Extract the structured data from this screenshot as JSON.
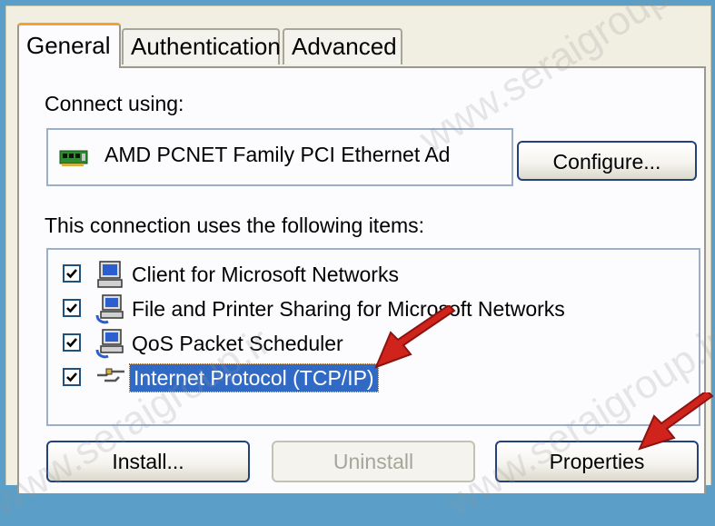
{
  "tabs": [
    {
      "label": "General",
      "active": true
    },
    {
      "label": "Authentication",
      "active": false
    },
    {
      "label": "Advanced",
      "active": false
    }
  ],
  "connect_using": {
    "label": "Connect using:",
    "adapter_name": "AMD PCNET Family PCI Ethernet Ad",
    "adapter_icon": "network-card-icon",
    "configure_label": "Configure..."
  },
  "items_section": {
    "label": "This connection uses the following items:",
    "items": [
      {
        "label": "Client for Microsoft Networks",
        "checked": true,
        "icon": "client-computer-icon",
        "selected": false
      },
      {
        "label": "File and Printer Sharing for Microsoft Networks",
        "checked": true,
        "icon": "file-printer-sharing-icon",
        "selected": false
      },
      {
        "label": "QoS Packet Scheduler",
        "checked": true,
        "icon": "qos-scheduler-icon",
        "selected": false
      },
      {
        "label": "Internet Protocol (TCP/IP)",
        "checked": true,
        "icon": "network-protocol-icon",
        "selected": true
      }
    ]
  },
  "buttons": {
    "install": "Install...",
    "uninstall": "Uninstall",
    "uninstall_enabled": false,
    "properties": "Properties"
  },
  "watermark": "www.seraigroup.ir",
  "colors": {
    "selection": "#316ac5",
    "active_tab_accent": "#f7a12c",
    "button_border": "#23417a",
    "annotation_arrow": "#d0231c"
  }
}
